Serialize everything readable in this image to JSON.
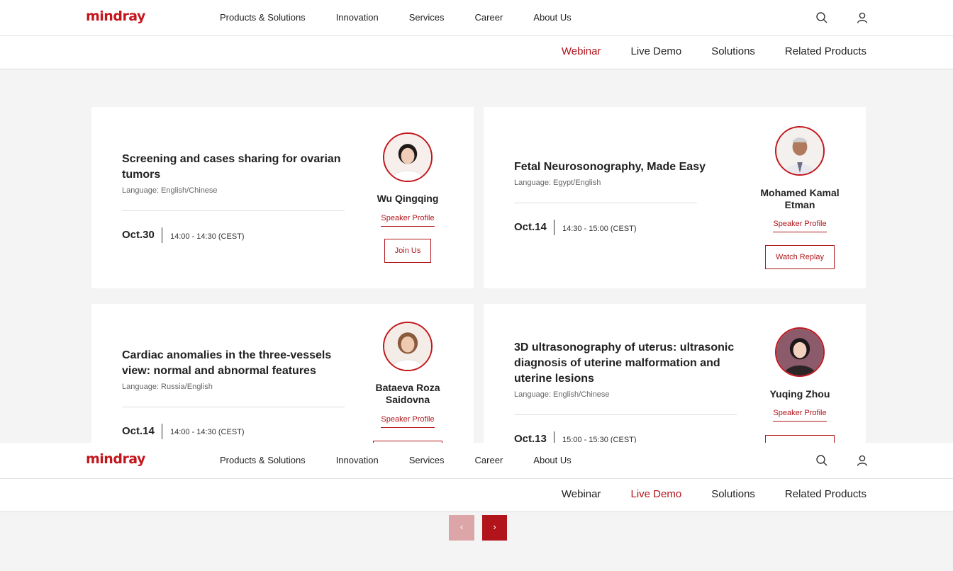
{
  "brand": {
    "logo_text": "mindray",
    "accent": "#c3161c"
  },
  "nav": {
    "items": [
      "Products & Solutions",
      "Innovation",
      "Services",
      "Career",
      "About Us"
    ]
  },
  "subnav_top": {
    "items": [
      "Webinar",
      "Live Demo",
      "Solutions",
      "Related Products"
    ],
    "active": "Webinar"
  },
  "subnav_bottom": {
    "items": [
      "Webinar",
      "Live Demo",
      "Solutions",
      "Related Products"
    ],
    "active": "Live Demo"
  },
  "webinars": [
    {
      "title": "Screening and cases sharing for ovarian tumors",
      "language": "Language: English/Chinese",
      "date": "Oct.30",
      "time": "14:00 - 14:30 (CEST)",
      "speaker": "Wu Qingqing",
      "profile_label": "Speaker Profile",
      "action_label": "Join Us"
    },
    {
      "title": "Fetal Neurosonography, Made Easy",
      "language": "Language: Egypt/English",
      "date": "Oct.14",
      "time": "14:30 - 15:00 (CEST)",
      "speaker": "Mohamed Kamal Etman",
      "profile_label": "Speaker Profile",
      "action_label": "Watch Replay"
    },
    {
      "title": "Cardiac anomalies in the three-vessels view: normal and abnormal features",
      "language": "Language: Russia/English",
      "date": "Oct.14",
      "time": "14:00 - 14:30 (CEST)",
      "speaker": "Bataeva Roza Saidovna",
      "profile_label": "Speaker Profile",
      "action_label": ""
    },
    {
      "title": "3D ultrasonography of uterus: ultrasonic diagnosis of uterine malformation and uterine lesions",
      "language": "Language: English/Chinese",
      "date": "Oct.13",
      "time": "15:00 - 15:30 (CEST)",
      "speaker": "Yuqing Zhou",
      "profile_label": "Speaker Profile",
      "action_label": ""
    }
  ],
  "pagination": {
    "prev_icon": "chevron-left-icon",
    "next_icon": "chevron-right-icon",
    "prev_glyph": "‹",
    "next_glyph": "›"
  }
}
